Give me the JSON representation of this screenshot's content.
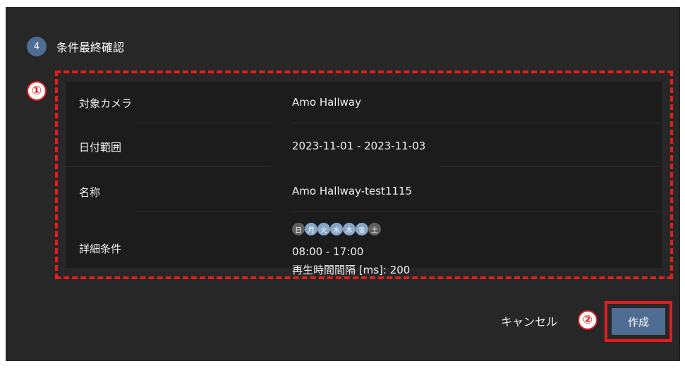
{
  "step": {
    "number": "4",
    "title": "条件最終確認"
  },
  "annotations": {
    "marker1": "①",
    "marker2": "②"
  },
  "summary": {
    "camera_label": "対象カメラ",
    "camera_value": "Amo Hallway",
    "date_label": "日付範囲",
    "date_value": "2023-11-01 - 2023-11-03",
    "name_label": "名称",
    "name_value": "Amo Hallway-test1115",
    "detail_label": "詳細条件",
    "days": [
      {
        "label": "日",
        "selected": false
      },
      {
        "label": "月",
        "selected": true
      },
      {
        "label": "火",
        "selected": true
      },
      {
        "label": "水",
        "selected": true
      },
      {
        "label": "木",
        "selected": true
      },
      {
        "label": "金",
        "selected": true
      },
      {
        "label": "土",
        "selected": false
      }
    ],
    "time_range": "08:00 - 17:00",
    "interval": "再生時間間隔 [ms]: 200"
  },
  "actions": {
    "cancel_label": "キャンセル",
    "create_label": "作成"
  },
  "colors": {
    "panel": "#272727",
    "accent": "#4f6c92",
    "highlight": "#e41c1c",
    "day_on": "#87a6c7",
    "day_off": "#5f5f5f"
  }
}
